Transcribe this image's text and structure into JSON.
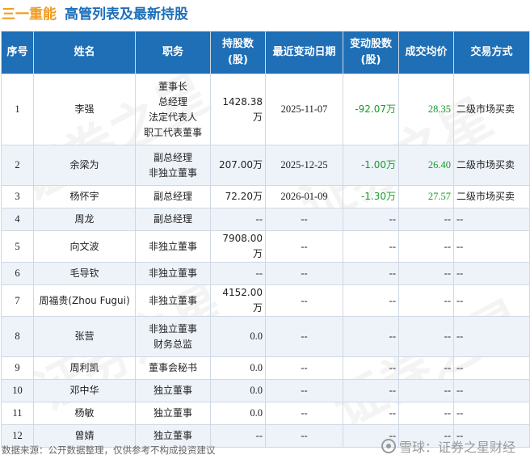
{
  "header": {
    "company": "三一重能",
    "title": "高管列表及最新持股"
  },
  "watermark": "证券之星",
  "table": {
    "columns": [
      "序号",
      "姓名",
      "职务",
      "持股数\n(股)",
      "最近变动日期",
      "变动股数\n(股)",
      "成交均价",
      "交易方式"
    ],
    "rows": [
      {
        "no": "1",
        "name": "李强",
        "positions": [
          "董事长",
          "总经理",
          "法定代表人",
          "职工代表董事"
        ],
        "shares": "1428.38万",
        "date": "2025-11-07",
        "change": "-92.07万",
        "price": "28.35",
        "method": "二级市场买卖"
      },
      {
        "no": "2",
        "name": "余梁为",
        "positions": [
          "副总经理",
          "非独立董事"
        ],
        "shares": "207.00万",
        "date": "2025-12-25",
        "change": "-1.00万",
        "price": "26.40",
        "method": "二级市场买卖"
      },
      {
        "no": "3",
        "name": "杨怀宇",
        "positions": [
          "副总经理"
        ],
        "shares": "72.20万",
        "date": "2026-01-09",
        "change": "-1.30万",
        "price": "27.57",
        "method": "二级市场买卖"
      },
      {
        "no": "4",
        "name": "周龙",
        "positions": [
          "副总经理"
        ],
        "shares": "--",
        "date": "--",
        "change": "--",
        "price": "--",
        "method": "--"
      },
      {
        "no": "5",
        "name": "向文波",
        "positions": [
          "非独立董事"
        ],
        "shares": "7908.00万",
        "date": "--",
        "change": "--",
        "price": "--",
        "method": "--"
      },
      {
        "no": "6",
        "name": "毛导钦",
        "positions": [
          "非独立董事"
        ],
        "shares": "--",
        "date": "--",
        "change": "--",
        "price": "--",
        "method": "--"
      },
      {
        "no": "7",
        "name": "周福贵(Zhou Fugui)",
        "positions": [
          "非独立董事"
        ],
        "shares": "4152.00万",
        "date": "--",
        "change": "--",
        "price": "--",
        "method": "--"
      },
      {
        "no": "8",
        "name": "张营",
        "positions": [
          "非独立董事",
          "财务总监"
        ],
        "shares": "0.0",
        "date": "--",
        "change": "--",
        "price": "--",
        "method": "--"
      },
      {
        "no": "9",
        "name": "周利凯",
        "positions": [
          "董事会秘书"
        ],
        "shares": "0.0",
        "date": "--",
        "change": "--",
        "price": "--",
        "method": "--"
      },
      {
        "no": "10",
        "name": "邓中华",
        "positions": [
          "独立董事"
        ],
        "shares": "0.0",
        "date": "--",
        "change": "--",
        "price": "--",
        "method": "--"
      },
      {
        "no": "11",
        "name": "杨敏",
        "positions": [
          "独立董事"
        ],
        "shares": "0.0",
        "date": "--",
        "change": "--",
        "price": "--",
        "method": "--"
      },
      {
        "no": "12",
        "name": "曾婧",
        "positions": [
          "独立董事"
        ],
        "shares": "--",
        "date": "--",
        "change": "--",
        "price": "--",
        "method": "--"
      }
    ]
  },
  "footer": {
    "source": "数据来源：公开数据整理，仅供参考不构成投资建议",
    "brand": "雪球：证券之星财经"
  },
  "colors": {
    "header_bg": "#1f6fb6",
    "company": "#f39a1c",
    "title": "#1e6fb8",
    "negative_change": "#1a9a2a",
    "price": "#1a9a2a",
    "alt_row": "#eef3fa"
  }
}
